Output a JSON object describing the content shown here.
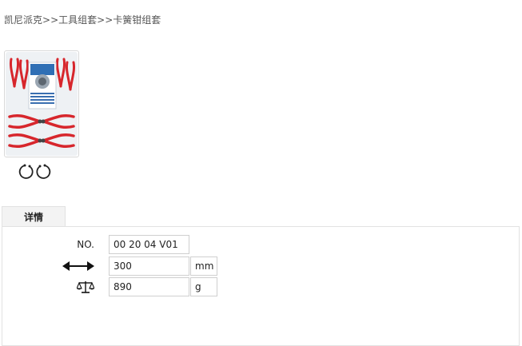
{
  "breadcrumb": {
    "items": [
      "凯尼派克",
      "工具组套",
      "卡簧钳组套"
    ],
    "separator": ">>"
  },
  "product": {
    "image": "circlip-pliers-set-photo",
    "feature_icons": [
      "internal-circlip-icon",
      "external-circlip-icon"
    ]
  },
  "tabs": [
    {
      "label": "详情"
    }
  ],
  "specs": [
    {
      "label": "NO.",
      "icon": null,
      "value": "00 20 04 V01",
      "unit": ""
    },
    {
      "label": "",
      "icon": "length-arrow-icon",
      "value": "300",
      "unit": "mm"
    },
    {
      "label": "",
      "icon": "weight-scale-icon",
      "value": "890",
      "unit": "g"
    }
  ],
  "colors": {
    "border": "#cfcfcf",
    "tab_bg": "#f3f3f3",
    "plier_red": "#d7262c"
  }
}
